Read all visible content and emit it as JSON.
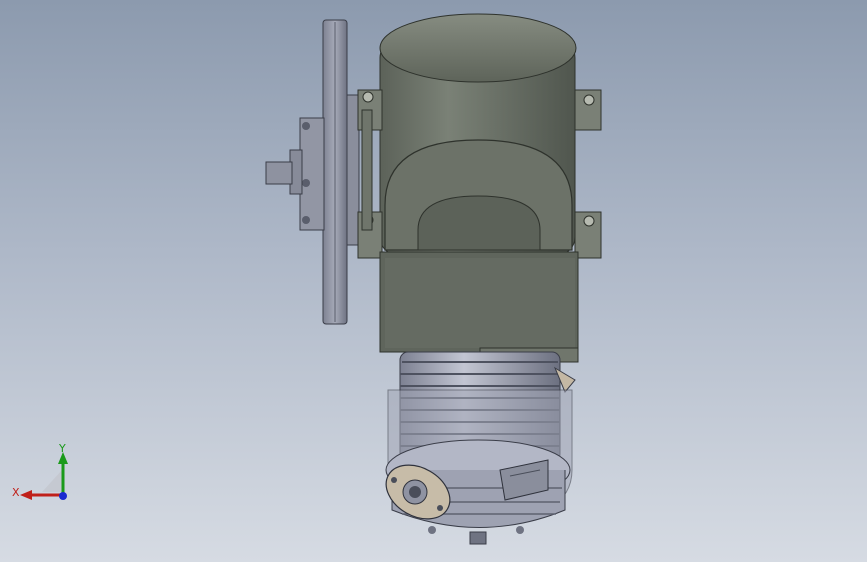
{
  "viewport": {
    "background_top": "#8c9aae",
    "background_bottom": "#d6dbe3"
  },
  "triad": {
    "x_label": "X",
    "y_label": "Y",
    "x_color": "#c0201a",
    "y_color": "#1a9a1a",
    "z_color": "#1a2ad0"
  },
  "model": {
    "icon": "engine-assembly-3d-model",
    "body_color": "#6b7268",
    "flywheel_color": "#8f93a3",
    "cylinder_color": "#a4a8b8"
  }
}
